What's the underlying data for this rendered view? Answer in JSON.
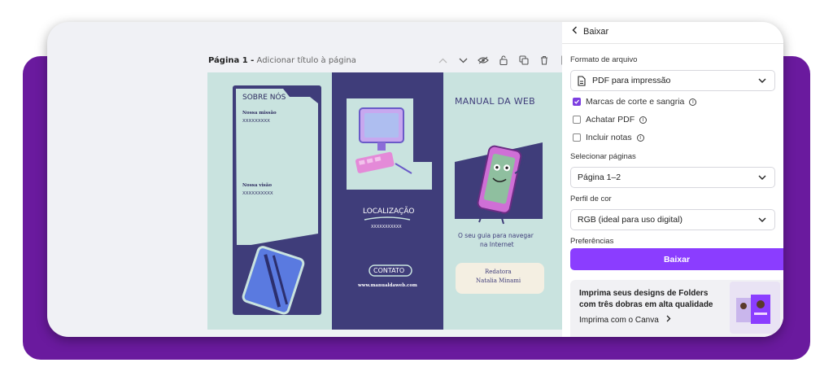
{
  "editor": {
    "page_title": "Página 1 -",
    "page_title_placeholder": "Adicionar título à página"
  },
  "brochure": {
    "about_title": "SOBRE NÓS",
    "mission_label": "Nossa missão",
    "mission_value": "XXXXXXXXX",
    "vision_label": "Nossa visão",
    "vision_value": "XXXXXXXXXX",
    "location_title": "LOCALIZAÇÃO",
    "location_value": "XXXXXXXXXXX",
    "contact_title": "CONTATO",
    "contact_site": "www.manualdaweb.com",
    "main_title": "MANUAL DA WEB",
    "tagline_1": "O seu guia para navegar",
    "tagline_2": "na Internet",
    "writer_label": "Redatora",
    "writer_name": "Natalia Minami"
  },
  "sidebar": {
    "back_label": "Baixar",
    "file_format_label": "Formato de arquivo",
    "file_format_value": "PDF para impressão",
    "options": [
      {
        "label": "Marcas de corte e sangria",
        "checked": true
      },
      {
        "label": "Achatar PDF",
        "checked": false
      },
      {
        "label": "Incluir notas",
        "checked": false
      }
    ],
    "pages_label": "Selecionar páginas",
    "pages_value": "Página 1–2",
    "color_profile_label": "Perfil de cor",
    "color_profile_value": "RGB (ideal para uso digital)",
    "preferences_label": "Preferências",
    "download_button": "Baixar",
    "promo_title": "Imprima seus designs de Folders com três dobras em alta qualidade",
    "promo_link": "Imprima com o Canva"
  },
  "colors": {
    "frame_purple": "#6a1a9e",
    "accent": "#8b3dff",
    "brochure_navy": "#3f3d7a",
    "brochure_mint": "#c9e3df"
  }
}
